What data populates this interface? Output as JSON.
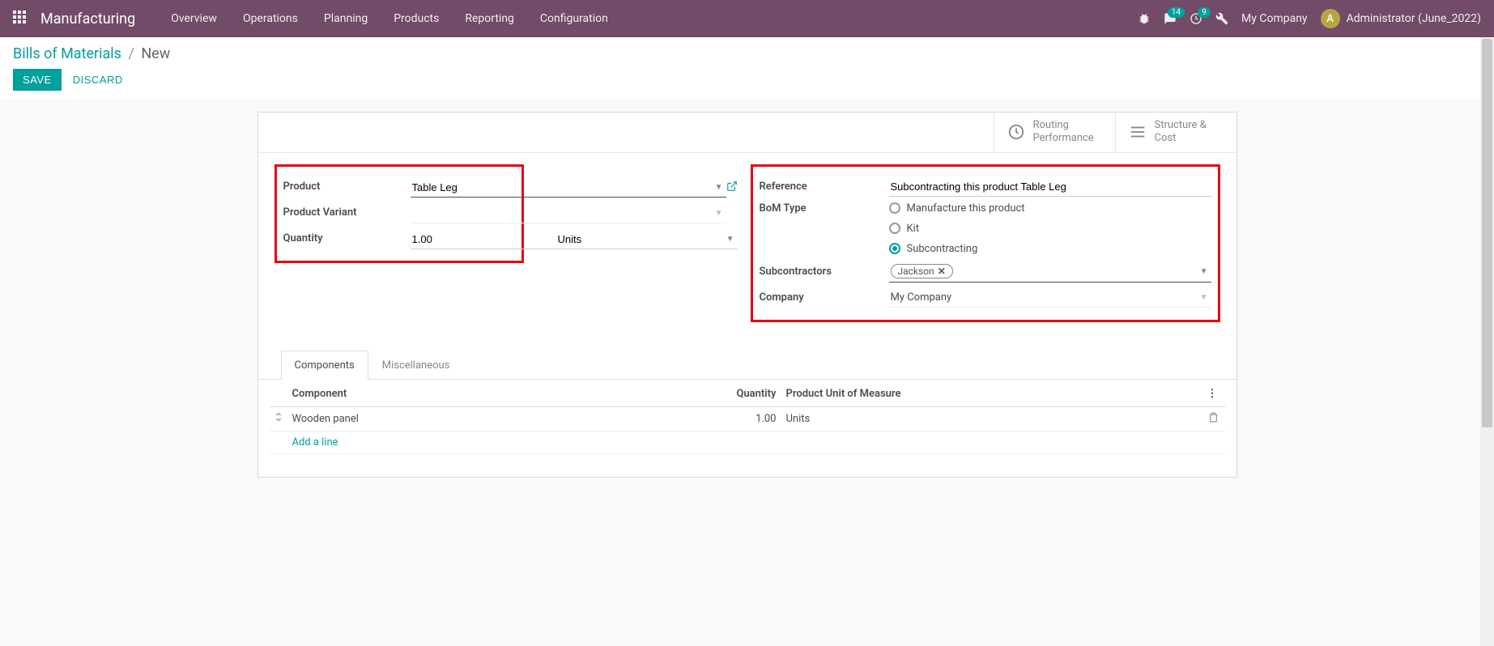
{
  "topnav": {
    "app_name": "Manufacturing",
    "menu": [
      "Overview",
      "Operations",
      "Planning",
      "Products",
      "Reporting",
      "Configuration"
    ],
    "msg_badge": "14",
    "activity_badge": "9",
    "company": "My Company",
    "avatar_initial": "A",
    "user": "Administrator (June_2022)"
  },
  "breadcrumb": {
    "parent": "Bills of Materials",
    "current": "New"
  },
  "actions": {
    "save": "SAVE",
    "discard": "DISCARD"
  },
  "stat_buttons": {
    "routing_l1": "Routing",
    "routing_l2": "Performance",
    "structure_l1": "Structure &",
    "structure_l2": "Cost"
  },
  "form": {
    "labels": {
      "product": "Product",
      "variant": "Product Variant",
      "quantity": "Quantity",
      "reference": "Reference",
      "bom_type": "BoM Type",
      "subcontractors": "Subcontractors",
      "company": "Company"
    },
    "product": "Table Leg",
    "variant": "",
    "quantity": "1.00",
    "uom": "Units",
    "reference": "Subcontracting this product Table Leg",
    "bom_type_options": {
      "manufacture": "Manufacture this product",
      "kit": "Kit",
      "subcontract": "Subcontracting"
    },
    "subcontractor_tag": "Jackson",
    "company": "My Company"
  },
  "tabs": {
    "components": "Components",
    "misc": "Miscellaneous"
  },
  "table": {
    "headers": {
      "component": "Component",
      "quantity": "Quantity",
      "uom": "Product Unit of Measure"
    },
    "row": {
      "component": "Wooden panel",
      "quantity": "1.00",
      "uom": "Units"
    },
    "add_line": "Add a line"
  }
}
